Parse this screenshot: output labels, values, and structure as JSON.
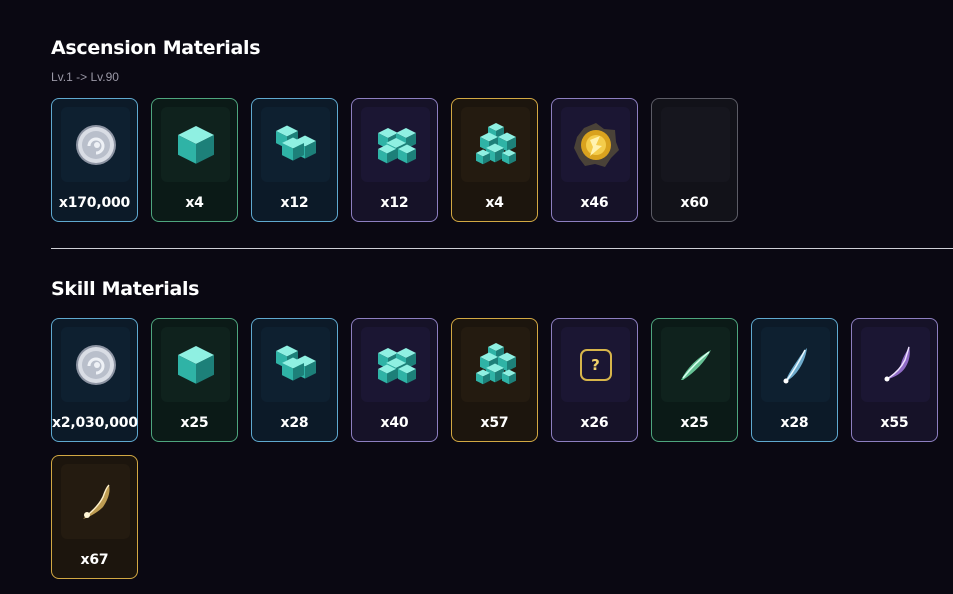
{
  "ascension": {
    "title": "Ascension Materials",
    "subtitle": "Lv.1 -> Lv.90",
    "items": [
      {
        "icon": "credit-coin-icon",
        "qty": "x170,000",
        "rarity": "blue"
      },
      {
        "icon": "cube-small-icon",
        "qty": "x4",
        "rarity": "green"
      },
      {
        "icon": "cube-stack-icon",
        "qty": "x12",
        "rarity": "blue"
      },
      {
        "icon": "cube-cluster-icon",
        "qty": "x12",
        "rarity": "purple"
      },
      {
        "icon": "cube-tower-icon",
        "qty": "x4",
        "rarity": "gold"
      },
      {
        "icon": "golden-orb-icon",
        "qty": "x46",
        "rarity": "purple"
      },
      {
        "icon": "empty-icon",
        "qty": "x60",
        "rarity": "grey"
      }
    ]
  },
  "skill": {
    "title": "Skill Materials",
    "items": [
      {
        "icon": "credit-coin-icon",
        "qty": "x2,030,000",
        "rarity": "blue"
      },
      {
        "icon": "cube-small-icon",
        "qty": "x25",
        "rarity": "green"
      },
      {
        "icon": "cube-stack-icon",
        "qty": "x28",
        "rarity": "blue"
      },
      {
        "icon": "cube-cluster-icon",
        "qty": "x40",
        "rarity": "purple"
      },
      {
        "icon": "cube-tower-icon",
        "qty": "x57",
        "rarity": "gold"
      },
      {
        "icon": "unknown-item-icon",
        "qty": "x26",
        "rarity": "purple",
        "glyph": "?"
      },
      {
        "icon": "green-wisp-icon",
        "qty": "x25",
        "rarity": "green"
      },
      {
        "icon": "blue-wisp-icon",
        "qty": "x28",
        "rarity": "blue"
      },
      {
        "icon": "purple-wisp-icon",
        "qty": "x55",
        "rarity": "purple"
      },
      {
        "icon": "gold-wisp-icon",
        "qty": "x67",
        "rarity": "gold"
      }
    ]
  },
  "colors": {
    "background": "#0a0812",
    "blue": "#5fa9cf",
    "green": "#4ea57e",
    "purple": "#8d7fc0",
    "gold": "#d2a843",
    "grey": "#5c5c66"
  }
}
